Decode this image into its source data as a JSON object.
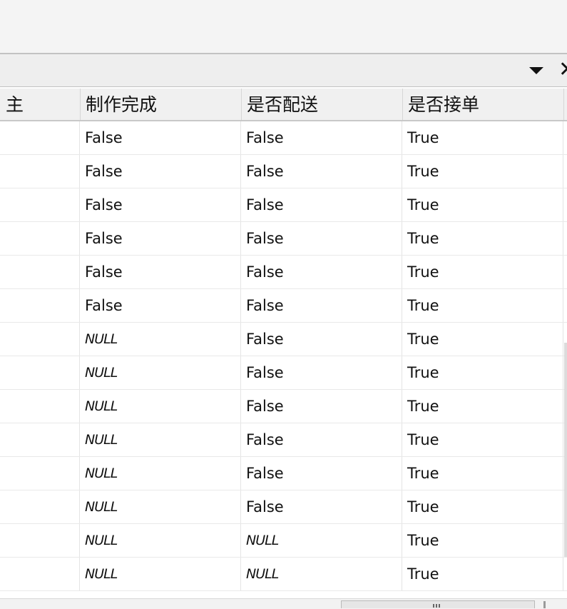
{
  "grid": {
    "columns": [
      "主",
      "制作完成",
      "是否配送",
      "是否接单"
    ],
    "rows": [
      [
        "",
        "False",
        "False",
        "True"
      ],
      [
        "",
        "False",
        "False",
        "True"
      ],
      [
        "",
        "False",
        "False",
        "True"
      ],
      [
        "",
        "False",
        "False",
        "True"
      ],
      [
        "",
        "False",
        "False",
        "True"
      ],
      [
        "",
        "False",
        "False",
        "True"
      ],
      [
        "",
        "NULL",
        "False",
        "True"
      ],
      [
        "",
        "NULL",
        "False",
        "True"
      ],
      [
        "",
        "NULL",
        "False",
        "True"
      ],
      [
        "",
        "NULL",
        "False",
        "True"
      ],
      [
        "",
        "NULL",
        "False",
        "True"
      ],
      [
        "",
        "NULL",
        "False",
        "True"
      ],
      [
        "",
        "NULL",
        "NULL",
        "True"
      ],
      [
        "",
        "NULL",
        "NULL",
        "True"
      ]
    ]
  },
  "panel": {
    "dropdown_icon": "chevron-down-icon",
    "close_icon": "close-icon"
  },
  "colors": {
    "header_bg": "#f0f0f0",
    "grid_line": "#e4e4e4",
    "text": "#111111"
  }
}
